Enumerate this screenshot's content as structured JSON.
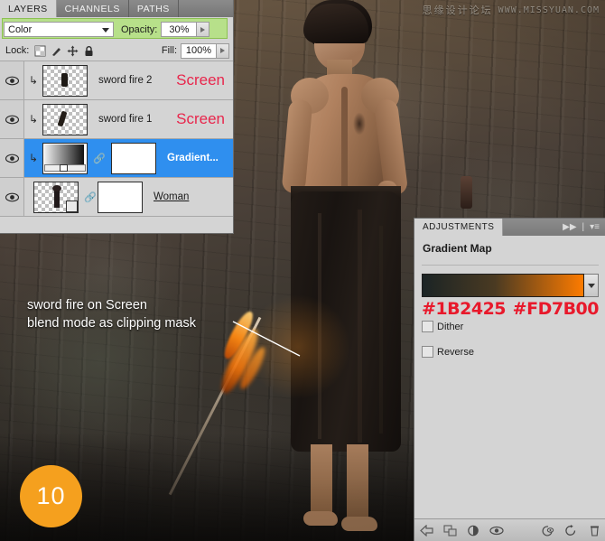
{
  "watermark": {
    "cn": "思缘设计论坛",
    "url": "WWW.MISSYUAN.COM"
  },
  "layers_panel": {
    "tabs": [
      {
        "label": "LAYERS",
        "active": true
      },
      {
        "label": "CHANNELS",
        "active": false
      },
      {
        "label": "PATHS",
        "active": false
      }
    ],
    "blend_mode": "Color",
    "opacity_label": "Opacity:",
    "opacity_value": "30%",
    "lock_label": "Lock:",
    "lock_icons": [
      "lock-transparency-icon",
      "lock-image-icon",
      "lock-position-icon",
      "lock-all-icon"
    ],
    "fill_label": "Fill:",
    "fill_value": "100%",
    "highlight_color": "#b7e08a",
    "selection_color": "#2f8fef",
    "blend_tag_color": "#e8264c",
    "rows": [
      {
        "name": "sword fire 2",
        "blend_tag": "Screen",
        "clipped": true,
        "selected": false,
        "kind": "pixel"
      },
      {
        "name": "sword fire 1",
        "blend_tag": "Screen",
        "clipped": true,
        "selected": false,
        "kind": "pixel"
      },
      {
        "name": "Gradient...",
        "blend_tag": "",
        "clipped": true,
        "selected": true,
        "kind": "gradient-map"
      },
      {
        "name": "Woman",
        "blend_tag": "",
        "clipped": false,
        "selected": false,
        "kind": "smart-object"
      }
    ]
  },
  "adjustments_panel": {
    "tab": "ADJUSTMENTS",
    "title": "Gradient Map",
    "gradient_start": "#1B2425",
    "gradient_end": "#FD7B00",
    "hex_left": "#1B2425",
    "hex_right": "#FD7B00",
    "dither_label": "Dither",
    "dither_checked": false,
    "reverse_label": "Reverse",
    "reverse_checked": false,
    "bottom_icons": [
      "back-arrow-icon",
      "clip-to-layer-icon",
      "toggle-adjustment-icon",
      "preview-eye-icon",
      "previous-state-icon",
      "reset-icon",
      "delete-icon"
    ]
  },
  "annotation": {
    "line1": "sword fire on Screen",
    "line2": "blend mode as clipping mask",
    "step_number": "10",
    "badge_color": "#f5a01e"
  }
}
